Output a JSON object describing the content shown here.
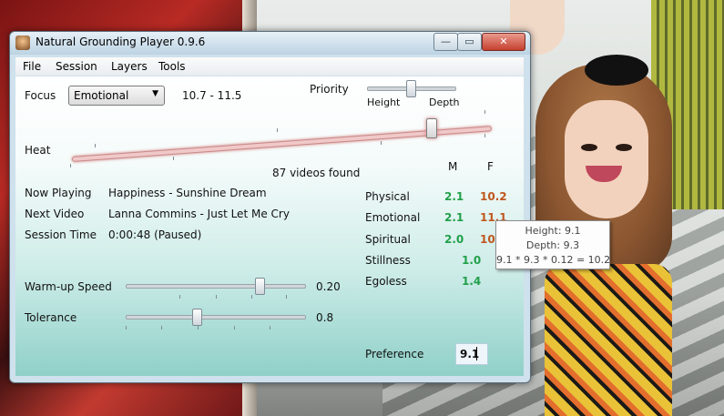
{
  "window": {
    "title": "Natural Grounding Player 0.9.6",
    "controls": {
      "minimize": "—",
      "maximize": "▭",
      "close": "✕"
    }
  },
  "menu": [
    "File",
    "Session",
    "Layers",
    "Tools"
  ],
  "focus": {
    "label": "Focus",
    "selected": "Emotional",
    "range": "10.7 - 11.5"
  },
  "priority": {
    "label": "Priority",
    "left_label": "Height",
    "right_label": "Depth",
    "level": 0.5
  },
  "heat": {
    "label": "Heat",
    "level": 0.88,
    "videos_found": "87 videos found"
  },
  "now_playing": {
    "label": "Now Playing",
    "value": "Happiness - Sunshine Dream"
  },
  "next_video": {
    "label": "Next Video",
    "value": "Lanna Commins - Just Let Me Cry"
  },
  "session_time": {
    "label": "Session Time",
    "value": "0:00:48 (Paused)"
  },
  "warmup": {
    "label": "Warm-up Speed",
    "value": "0.20",
    "level": 0.75
  },
  "tolerance": {
    "label": "Tolerance",
    "value": "0.8",
    "level": 0.4
  },
  "ratings": {
    "col_m": "M",
    "col_f": "F",
    "rows": [
      {
        "label": "Physical",
        "m": "2.1",
        "f": "10.2"
      },
      {
        "label": "Emotional",
        "m": "2.1",
        "f": "11.1"
      },
      {
        "label": "Spiritual",
        "m": "2.0",
        "f": "10."
      },
      {
        "label": "Stillness",
        "m": "1.0",
        "f": ""
      },
      {
        "label": "Egoless",
        "m": "1.4",
        "f": ""
      }
    ]
  },
  "preference": {
    "label": "Preference",
    "value": "9.1"
  },
  "tooltip": {
    "line1": "Height: 9.1",
    "line2": "Depth: 9.3",
    "line3": "9.1 * 9.3 * 0.12 = 10.2"
  },
  "colors": {
    "green": "#22a04a",
    "orange": "#c0571e",
    "accent": "#8fd0c8"
  }
}
